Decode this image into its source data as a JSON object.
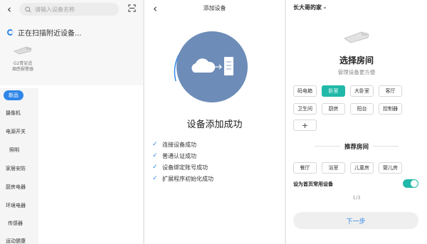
{
  "scan_panel": {
    "search_placeholder": "请输入设备名称",
    "scanning_text": "正在扫描附近设备...",
    "device": {
      "name_line1": "G2青安适",
      "name_line2": "烟感报警器"
    },
    "categories": [
      "新品",
      "摄像机",
      "电源开关",
      "照明",
      "家居安防",
      "厨房电器",
      "环境电器",
      "传感器",
      "运动健康"
    ]
  },
  "add_panel": {
    "title": "添加设备",
    "success_title": "设备添加成功",
    "steps": [
      "连接设备成功",
      "普通认证成功",
      "设备绑定账号成功",
      "扩展程序初始化成功"
    ]
  },
  "room_panel": {
    "home_name": "长大哥的家",
    "title": "选择房间",
    "subtitle": "管理设备更方便",
    "rooms": [
      "码电箱",
      "卧室",
      "大卧室",
      "客厅",
      "卫生间",
      "厨房",
      "阳台",
      "控制器"
    ],
    "selected_room": "卧室",
    "add_label": "+",
    "recommended_title": "推荐房间",
    "recommended_rooms": [
      "餐厅",
      "浴室",
      "儿童房",
      "婴儿房"
    ],
    "toggle_label": "设为首页常用设备",
    "toggle_on": true,
    "pager": "1/3",
    "next_label": "下一步"
  },
  "colors": {
    "accent": "#2f86e8",
    "room_selected": "#20b8a8",
    "illustration": "#6d8cb8"
  }
}
